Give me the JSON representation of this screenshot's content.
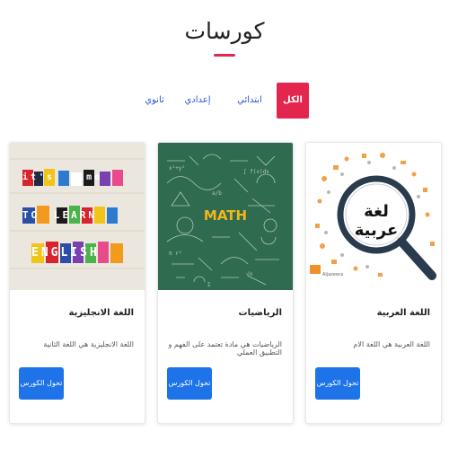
{
  "page": {
    "title": "كورسات"
  },
  "tabs": [
    {
      "label": "الكل",
      "active": true
    },
    {
      "label": "ابتدائي",
      "active": false
    },
    {
      "label": "إعدادي",
      "active": false
    },
    {
      "label": "ثانوي",
      "active": false
    }
  ],
  "cards": [
    {
      "title": "اللغة العربية",
      "description": "اللغة العربية هي اللغة الام",
      "button": "تحول الكورس",
      "image_text": "لغة عربية",
      "image_caption": "Aljazeera"
    },
    {
      "title": "الرياضيات",
      "description": "الرياضيات هي مادة تعتمد على الفهم و التطبيق العملي",
      "button": "تحول الكورس",
      "image_text": "MATH"
    },
    {
      "title": "اللغة الانجليزية",
      "description": "اللغة الانجليزية هي اللغة الثانية",
      "button": "تحول الكورس",
      "image_text": [
        "it's",
        "time",
        "TO",
        "LEARN",
        "ENGLISH"
      ]
    }
  ],
  "colors": {
    "accent": "#e2264d",
    "link": "#2f55d4",
    "button": "#1e73e8",
    "chalkboard": "#2f6b4e"
  }
}
